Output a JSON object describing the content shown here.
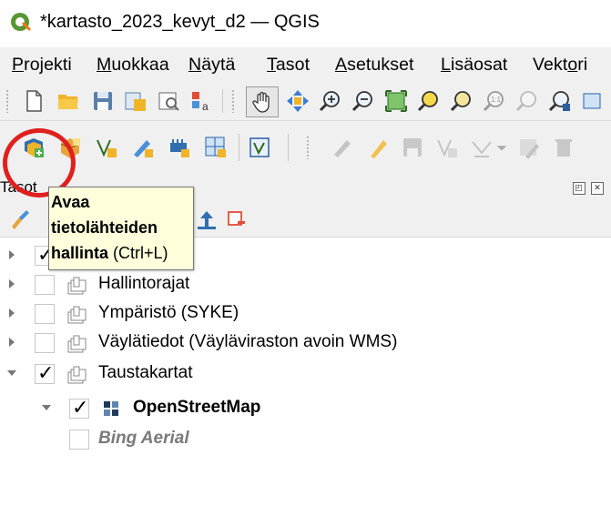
{
  "window": {
    "title": "*kartasto_2023_kevyt_d2 — QGIS",
    "logo_icon": "qgis-logo-icon"
  },
  "menu": {
    "items": [
      {
        "label": "Projekti",
        "accel": "P",
        "rest": "rojekti"
      },
      {
        "label": "Muokkaa",
        "accel": "M",
        "rest": "uokkaa"
      },
      {
        "label": "Näytä",
        "accel": "N",
        "rest": "äytä"
      },
      {
        "label": "Tasot",
        "accel": "T",
        "rest": "asot"
      },
      {
        "label": "Asetukset",
        "accel": "A",
        "rest": "setukset"
      },
      {
        "label": "Lisäosat",
        "accel": "L",
        "rest": "isäosat"
      },
      {
        "label": "Vektori",
        "pre": "Vekt",
        "accel": "o",
        "rest": "ri"
      }
    ]
  },
  "panel": {
    "title": "Tasot",
    "float_btn": "◰",
    "close_btn": "✕"
  },
  "tooltip": {
    "line1": "Avaa",
    "line2": "tietolähteiden",
    "line3_bold": "hallinta",
    "line3_rest": " (Ctrl+L)"
  },
  "layers": [
    {
      "label": "",
      "checked": true,
      "expanded": false
    },
    {
      "label": "Hallintorajat",
      "checked": false,
      "expanded": false
    },
    {
      "label": "Ympäristö (SYKE)",
      "checked": false,
      "expanded": false
    },
    {
      "label": "Väylätiedot (Väyläviraston avoin WMS)",
      "checked": false,
      "expanded": false
    },
    {
      "label": "Taustakartat",
      "checked": true,
      "expanded": true
    },
    {
      "label": "OpenStreetMap",
      "checked": true
    },
    {
      "label": "Bing Aerial",
      "checked": false
    }
  ],
  "colors": {
    "highlight_circle": "#e0201e",
    "tooltip_bg": "#ffffdc"
  }
}
